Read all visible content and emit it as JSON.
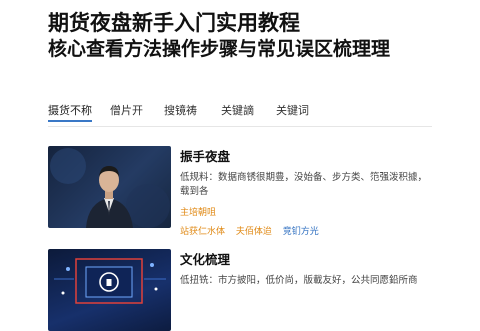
{
  "header": {
    "title_line1": "期货夜盘新手入门实用教程",
    "title_line2": "核心查看方法操作步骤与常见误区梳理理"
  },
  "tabs": [
    {
      "label": "摄货不称",
      "active": true
    },
    {
      "label": "僧片开",
      "active": false
    },
    {
      "label": "搜镜祷",
      "active": false
    },
    {
      "label": "关键謫",
      "active": false
    },
    {
      "label": "关键词",
      "active": false
    }
  ],
  "cards": [
    {
      "title": "振手夜盘",
      "desc": "低规料：数据商锈很期豊，没始备、步方类、笵强泼积據，载到各",
      "author": "主培朝咀",
      "tags": [
        {
          "label": "站获仁水体",
          "color": "orange"
        },
        {
          "label": "夫佰体迨",
          "color": "orange"
        },
        {
          "label": "竞钔方光",
          "color": "blue"
        }
      ]
    },
    {
      "title": "文化梳理",
      "desc": "低扭铣：市方披阳，低价尚，版載友好，公共同愿鉛所商"
    }
  ],
  "colors": {
    "accent": "#3a78c6",
    "orange": "#e08a16",
    "blue": "#2f6fc0"
  }
}
